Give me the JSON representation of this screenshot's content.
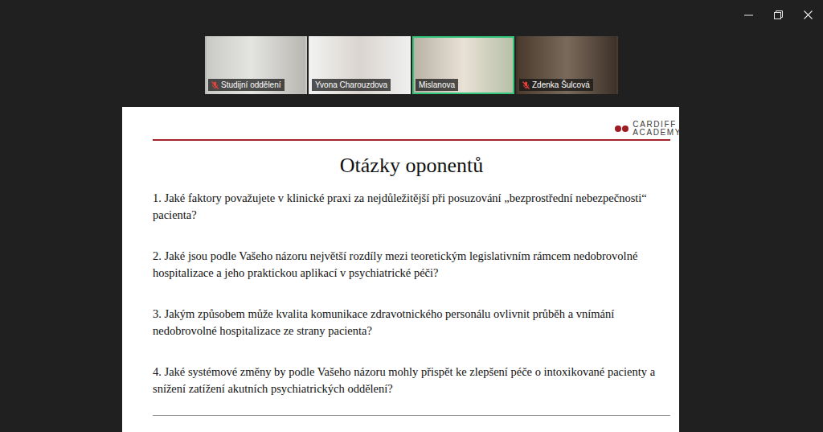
{
  "participants": [
    {
      "name": "Studijní oddělení",
      "muted": true,
      "speaking": false
    },
    {
      "name": "Yvona Charouzdova",
      "muted": false,
      "speaking": false
    },
    {
      "name": "Mislanova",
      "muted": false,
      "speaking": true
    },
    {
      "name": "Zdenka Šulcová",
      "muted": true,
      "speaking": false
    }
  ],
  "slide": {
    "logo": [
      "CARDIFF",
      "ACADEMY"
    ],
    "title": "Otázky oponentů",
    "questions": [
      "1. Jaké faktory považujete v klinické praxi za nejdůležitější při posuzování „bezprostřední nebezpečnosti“ pacienta?",
      "2. Jaké jsou podle Vašeho názoru největší rozdíly mezi teoretickým legislativním rámcem nedobrovolné hospitalizace a jeho praktickou aplikací v psychiatrické péči?",
      "3. Jakým způsobem může kvalita komunikace zdravotnického personálu ovlivnit průběh a vnímání nedobrovolné hospitalizace ze strany pacienta?",
      "4. Jaké systémové změny by podle Vašeho názoru mohly přispět ke zlepšení péče o intoxikované pacienty a snížení zatížení akutních psychiatrických oddělení?"
    ]
  }
}
